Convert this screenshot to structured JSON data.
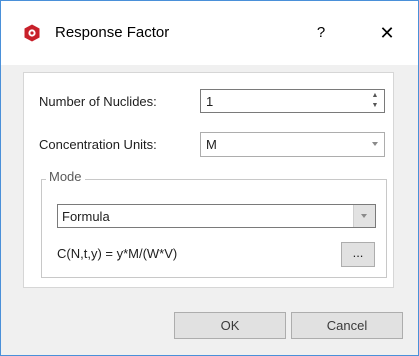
{
  "window": {
    "title": "Response Factor",
    "help_label": "?",
    "close_label": "✕",
    "app_icon": "app-logo-icon",
    "accent_color": "#c8202a"
  },
  "form": {
    "nuclides_label": "Number of Nuclides:",
    "nuclides_value": "1",
    "units_label": "Concentration Units:",
    "units_value": "M"
  },
  "mode": {
    "group_label": "Mode",
    "selected": "Formula",
    "formula": "C(N,t,y) = y*M/(W*V)",
    "edit_label": "..."
  },
  "buttons": {
    "ok_label": "OK",
    "cancel_label": "Cancel"
  }
}
